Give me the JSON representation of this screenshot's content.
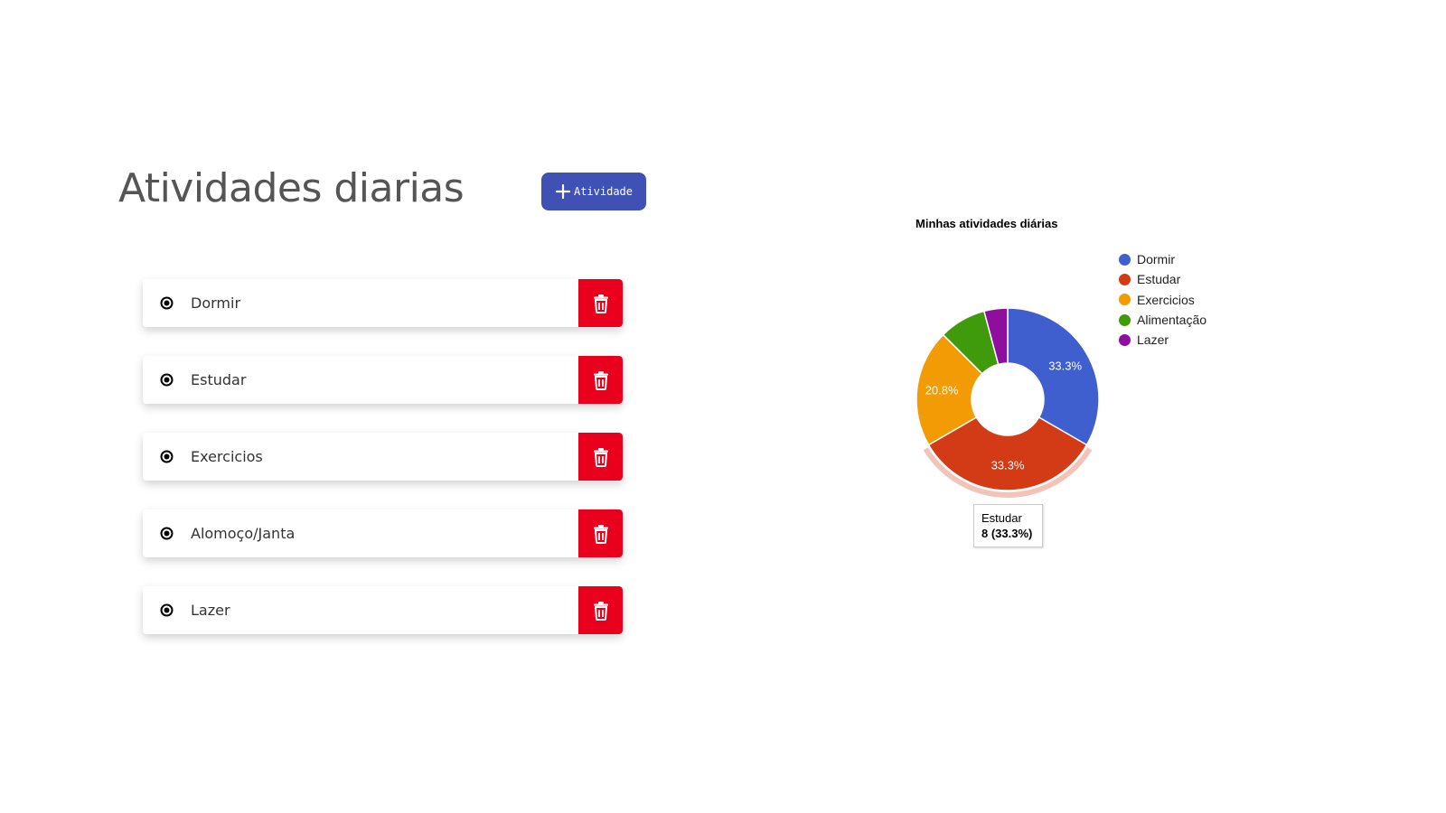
{
  "header": {
    "title": "Atividades diarias",
    "add_button_label": "Atividade"
  },
  "activities": [
    {
      "name": "Dormir"
    },
    {
      "name": "Estudar"
    },
    {
      "name": "Exercicios"
    },
    {
      "name": "Alomoço/Janta"
    },
    {
      "name": "Lazer"
    }
  ],
  "colors": {
    "accent": "#3f51b5",
    "delete": "#e8001c",
    "title_text": "#555555"
  },
  "icons": {
    "add": "plus-icon",
    "radio": "radio-checked-icon",
    "delete": "trash-icon"
  },
  "chart_data": {
    "type": "pie",
    "donut": true,
    "title": "Minhas atividades diárias",
    "legend_position": "right",
    "categories": [
      "Dormir",
      "Estudar",
      "Exercicios",
      "Alimentação",
      "Lazer"
    ],
    "values": [
      8,
      8,
      5,
      2,
      1
    ],
    "labels": [
      "33.3%",
      "33.3%",
      "20.8%",
      "",
      ""
    ],
    "colors": [
      "#3f5fcf",
      "#d33b17",
      "#f29b05",
      "#3f9a0c",
      "#8e0f9e"
    ],
    "highlighted": "Estudar",
    "tooltip": {
      "title": "Estudar",
      "value": "8 (33.3%)"
    }
  }
}
